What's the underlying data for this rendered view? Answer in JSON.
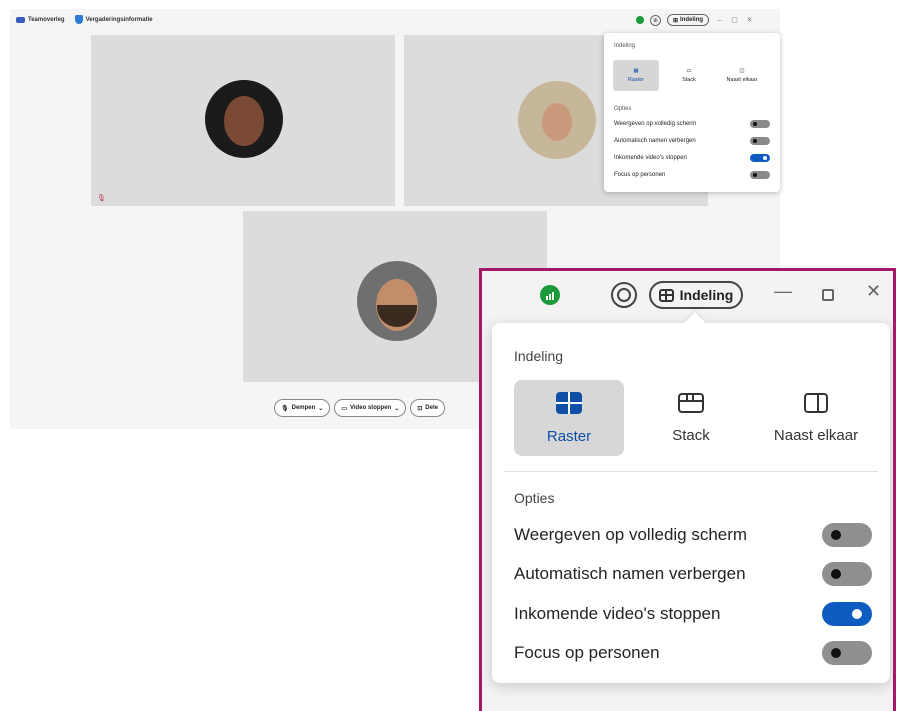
{
  "window": {
    "tabs": [
      "Teamoverleg",
      "Vergaderingsinformatie"
    ],
    "layout_label": "Indeling",
    "colors": {
      "accent": "#0f5cc0",
      "status_green": "#1a9a3a",
      "callout_border": "#a3186b"
    }
  },
  "controls": {
    "mute": "Dempen",
    "video": "Video stoppen",
    "share": "Dele"
  },
  "popover": {
    "layout_section": "Indeling",
    "layouts": [
      {
        "label": "Raster",
        "icon": "grid-layout-icon",
        "selected": true
      },
      {
        "label": "Stack",
        "icon": "stack-layout-icon",
        "selected": false
      },
      {
        "label": "Naast elkaar",
        "icon": "side-by-side-icon",
        "selected": false
      }
    ],
    "options_section": "Opties",
    "options": [
      {
        "label": "Weergeven op volledig scherm",
        "on": false
      },
      {
        "label": "Automatisch namen verbergen",
        "on": false
      },
      {
        "label": "Inkomende video's stoppen",
        "on": true
      },
      {
        "label": "Focus op personen",
        "on": false
      }
    ]
  }
}
